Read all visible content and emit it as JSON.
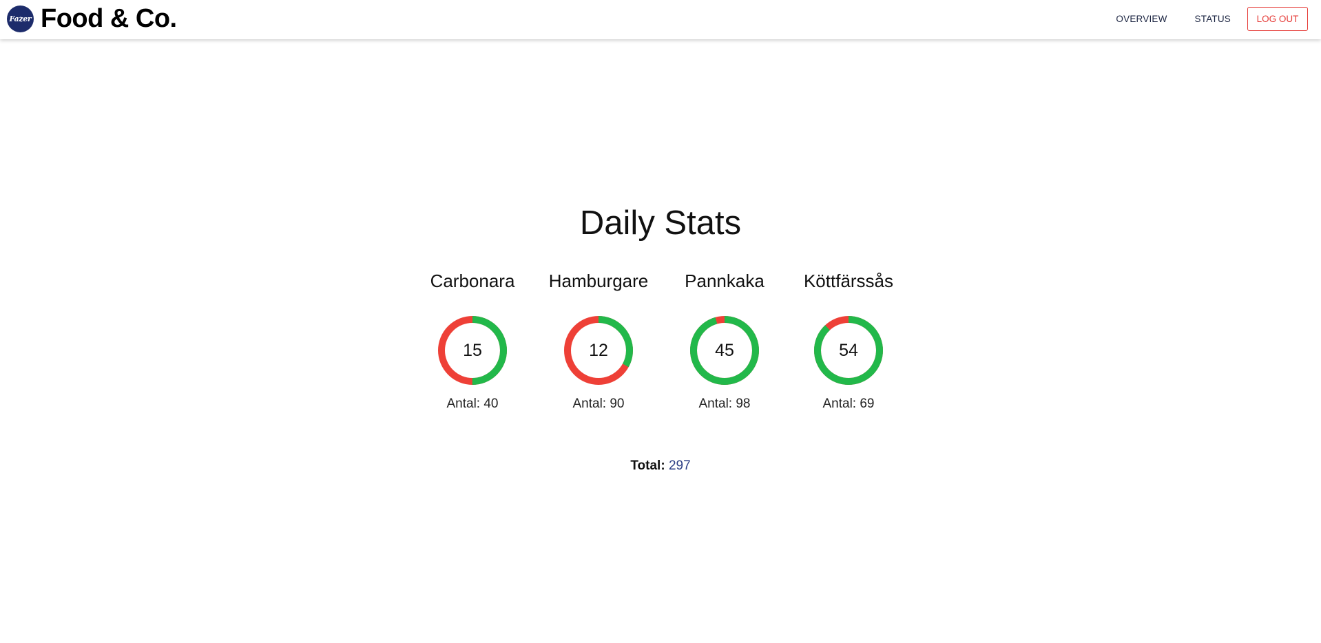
{
  "header": {
    "logo_text": "Fazer",
    "brand": "Food & Co.",
    "nav": [
      "OVERVIEW",
      "STATUS"
    ],
    "logout_label": "LOG OUT"
  },
  "main": {
    "title": "Daily Stats",
    "stats": [
      {
        "name": "Carbonara",
        "value": "15",
        "count_label": "Antal: 40",
        "good_fraction": 0.5
      },
      {
        "name": "Hamburgare",
        "value": "12",
        "count_label": "Antal: 90",
        "good_fraction": 0.33
      },
      {
        "name": "Pannkaka",
        "value": "45",
        "count_label": "Antal: 98",
        "good_fraction": 0.955
      },
      {
        "name": "Köttfärssås",
        "value": "54",
        "count_label": "Antal: 69",
        "good_fraction": 0.88
      }
    ],
    "total_label": "Total:",
    "total_value": "297"
  },
  "colors": {
    "good": "#22b84a",
    "bad": "#ee4037",
    "accent": "#2c3e85",
    "danger": "#e53935"
  },
  "icons": {
    "logo": "fazer-logo-icon"
  }
}
